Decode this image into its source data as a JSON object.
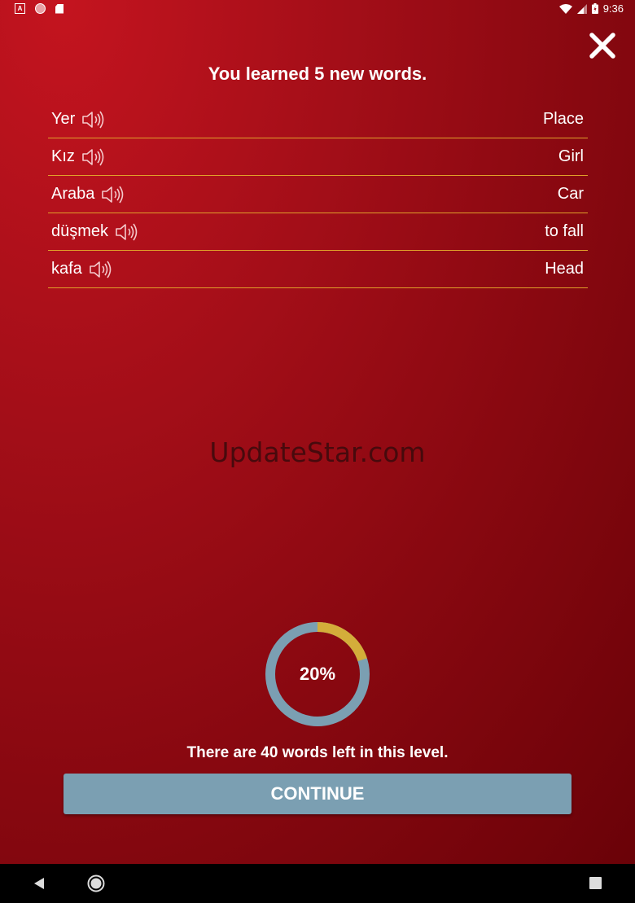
{
  "status_bar": {
    "time": "9:36",
    "left_icons": [
      "a-box-icon",
      "record-icon",
      "sd-card-icon"
    ],
    "right_icons": [
      "wifi-icon",
      "signal-icon",
      "battery-icon"
    ]
  },
  "title": "You learned 5 new words.",
  "words": [
    {
      "term": "Yer",
      "translation": "Place"
    },
    {
      "term": "Kız",
      "translation": "Girl"
    },
    {
      "term": "Araba",
      "translation": "Car"
    },
    {
      "term": "düşmek",
      "translation": "to fall"
    },
    {
      "term": "kafa",
      "translation": "Head"
    }
  ],
  "watermark": "UpdateStar.com",
  "progress": {
    "label": "20%",
    "fraction": 0.2,
    "colors": {
      "filled": "#d4ad3a",
      "track": "#7b9fb2"
    }
  },
  "words_left_message": "There are 40 words left in this level.",
  "continue_label": "CONTINUE",
  "colors": {
    "background": "#a30e18",
    "divider": "#e0a02a",
    "button": "#7b9fb2"
  }
}
